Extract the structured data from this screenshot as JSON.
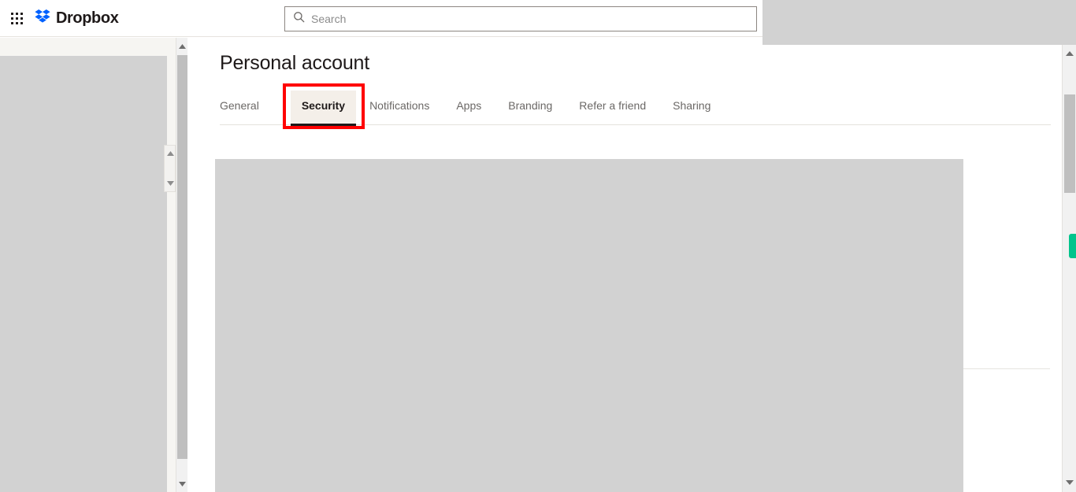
{
  "header": {
    "app_grid_icon": "grid-apps-icon",
    "brand_name": "Dropbox",
    "brand_logo_icon": "dropbox-logo-icon",
    "brand_color": "#0061FF",
    "search": {
      "icon": "search-icon",
      "placeholder": "Search",
      "value": ""
    }
  },
  "main": {
    "page_title": "Personal account",
    "tabs": [
      {
        "label": "General",
        "active": false
      },
      {
        "label": "Security",
        "active": true
      },
      {
        "label": "Notifications",
        "active": false
      },
      {
        "label": "Apps",
        "active": false
      },
      {
        "label": "Branding",
        "active": false
      },
      {
        "label": "Refer a friend",
        "active": false
      },
      {
        "label": "Sharing",
        "active": false
      }
    ],
    "active_tab": "Security",
    "highlight_color": "#FF0000",
    "active_tab_bg": "#F4EFE9"
  },
  "scrollbars": {
    "sidebar_up_arrow_icon": "scroll-up-arrow-icon",
    "sidebar_down_arrow_icon": "scroll-down-arrow-icon",
    "content_up_arrow_icon": "scroll-up-arrow-icon",
    "content_down_arrow_icon": "scroll-down-arrow-icon"
  },
  "accents": {
    "green_marker_color": "#00C48C"
  }
}
